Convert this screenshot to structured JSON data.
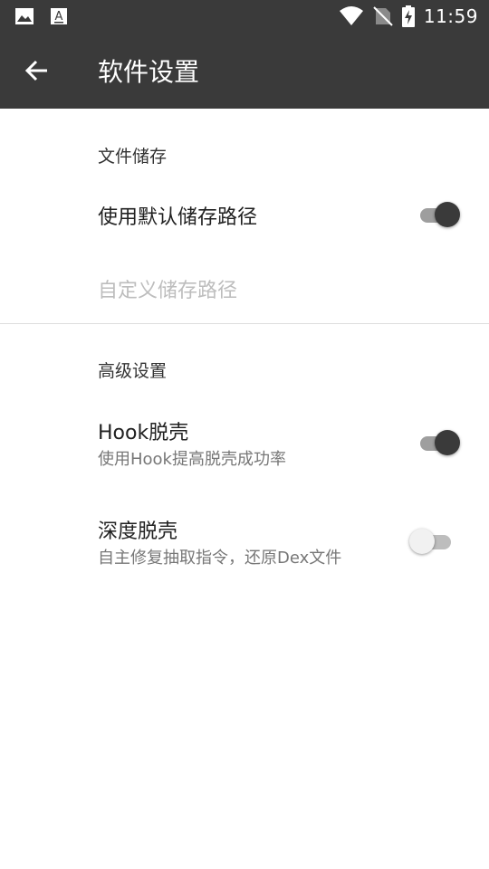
{
  "status_bar": {
    "time": "11:59",
    "left_icons": [
      "image-icon",
      "font-download-icon"
    ],
    "right_icons": [
      "wifi-icon",
      "no-sim-icon",
      "battery-charging-icon"
    ]
  },
  "app_bar": {
    "title": "软件设置",
    "back_icon": "arrow-back-icon"
  },
  "sections": {
    "storage": {
      "header": "文件储存",
      "use_default_path": {
        "title": "使用默认储存路径",
        "enabled": true
      },
      "custom_path": {
        "title": "自定义储存路径",
        "disabled": true
      }
    },
    "advanced": {
      "header": "高级设置",
      "hook_unpack": {
        "title": "Hook脱壳",
        "summary": "使用Hook提高脱壳成功率",
        "enabled": true
      },
      "deep_unpack": {
        "title": "深度脱壳",
        "summary": "自主修复抽取指令，还原Dex文件",
        "enabled": false
      }
    }
  },
  "colors": {
    "toolbar": "#3a3a3a",
    "switch_on_thumb": "#3a3a3a",
    "switch_off_thumb": "#f1f1f1"
  }
}
